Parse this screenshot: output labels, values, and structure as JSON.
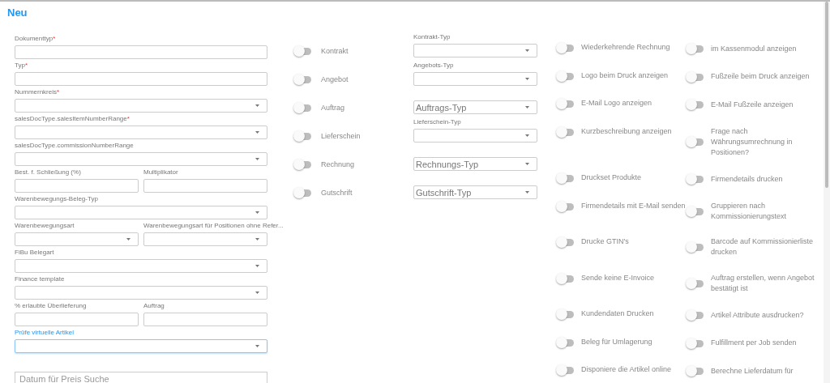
{
  "title": "Neu",
  "left_rows": [
    [
      {
        "label": "Dokumenttyp",
        "required_mark": "*",
        "kind": "text",
        "focused": false
      }
    ],
    [
      {
        "label": "Typ",
        "required_mark": "*",
        "kind": "text",
        "focused": false
      }
    ],
    [
      {
        "label": "Nummernkreis",
        "required_mark": "*",
        "kind": "select",
        "focused": false
      }
    ],
    [
      {
        "label": "salesDocType.salesItemNumberRange",
        "required_mark": "*",
        "kind": "select",
        "focused": false
      }
    ],
    [
      {
        "label": "salesDocType.commissionNumberRange",
        "kind": "select",
        "focused": false
      }
    ],
    [
      {
        "label": "Best. f. Schließung (%)",
        "kind": "text",
        "focused": false
      },
      {
        "label": "Multiplikator",
        "kind": "text",
        "focused": false
      }
    ],
    [
      {
        "label": "Warenbewegungs-Beleg-Typ",
        "kind": "select",
        "focused": false
      }
    ],
    [
      {
        "label": "Warenbewegungsart",
        "kind": "select",
        "focused": false
      },
      {
        "label": "Warenbewegungsart für Positionen ohne Refer...",
        "kind": "select",
        "focused": false
      }
    ],
    [
      {
        "label": "FiBu Belegart",
        "kind": "select",
        "focused": false
      }
    ],
    [
      {
        "label": "Finance template",
        "kind": "select",
        "focused": false
      }
    ],
    [
      {
        "label": "% erlaubte Überlieferung",
        "kind": "text",
        "focused": false
      },
      {
        "label": "Auftrag",
        "kind": "text",
        "focused": false
      }
    ],
    [
      {
        "label": "Prüfe virtuelle Artikel",
        "kind": "select",
        "focused": true
      }
    ]
  ],
  "date_field": {
    "placeholder": "Datum für Preis Suche"
  },
  "doc_types": [
    {
      "toggle": "Kontrakt",
      "on": false,
      "select_label": "Kontrakt-Typ"
    },
    {
      "toggle": "Angebot",
      "on": false,
      "select_label": "Angebots-Typ"
    },
    {
      "toggle": "Auftrag",
      "on": false,
      "select_placeholder": "Auftrags-Typ"
    },
    {
      "toggle": "Lieferschein",
      "on": false,
      "select_label": "Lieferschein-Typ"
    },
    {
      "toggle": "Rechnung",
      "on": false,
      "select_placeholder": "Rechnungs-Typ"
    },
    {
      "toggle": "Gutschrift",
      "on": false,
      "select_placeholder": "Gutschrift-Typ"
    }
  ],
  "options": [
    {
      "label": "Wiederkehrende Rechnung",
      "on": false
    },
    {
      "label": "im Kassenmodul anzeigen",
      "on": false
    },
    {
      "label": "Logo beim Druck anzeigen",
      "on": false
    },
    {
      "label": "Fußzeile beim Druck anzeigen",
      "on": false
    },
    {
      "label": "E-Mail Logo anzeigen",
      "on": false
    },
    {
      "label": "E-Mail Fußzeile anzeigen",
      "on": false
    },
    {
      "label": "Kurzbeschreibung anzeigen",
      "on": false
    },
    {
      "label": "Frage nach Währungsumrechnung in Positionen?",
      "on": false
    },
    {
      "label": "Druckset Produkte",
      "on": false
    },
    {
      "label": "Firmendetails drucken",
      "on": false
    },
    {
      "label": "Firmendetails mit E-Mail senden",
      "on": false
    },
    {
      "label": "Gruppieren nach Kommissionierungstext",
      "on": false
    },
    {
      "label": "Drucke GTIN's",
      "on": false
    },
    {
      "label": "Barcode auf Kommissionierliste drucken",
      "on": false
    },
    {
      "label": "Sende keine E-Invoice",
      "on": false
    },
    {
      "label": "Auftrag erstellen, wenn Angebot bestätigt ist",
      "on": false
    },
    {
      "label": "Kundendaten Drucken",
      "on": false
    },
    {
      "label": "Artikel Attribute ausdrucken?",
      "on": false
    },
    {
      "label": "Beleg für Umlagerung",
      "on": false
    },
    {
      "label": "Fulfillment per Job senden",
      "on": false
    },
    {
      "label": "Disponiere die Artikel online",
      "on": false
    },
    {
      "label": "Berechne Lieferdatum für",
      "on": false
    }
  ]
}
